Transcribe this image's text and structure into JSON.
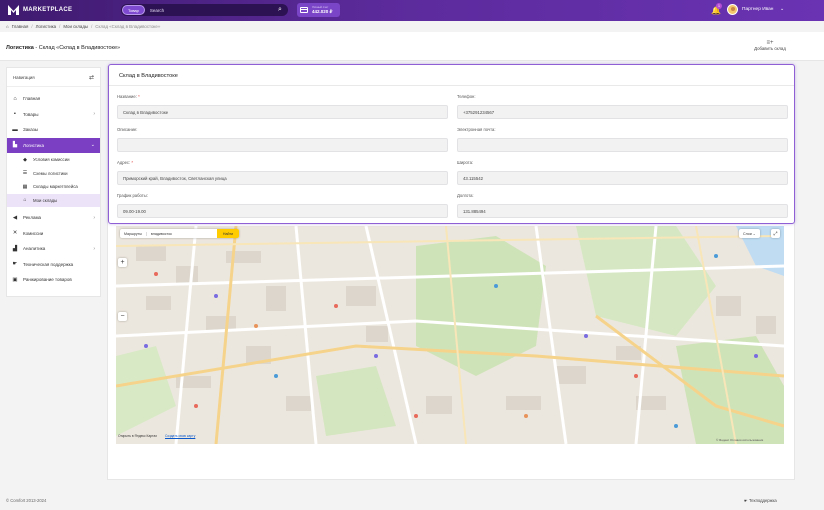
{
  "brand": {
    "name": "MARKETPLACE"
  },
  "search": {
    "scope": "Товар",
    "placeholder": "Search"
  },
  "balance": {
    "label": "Личный счет",
    "value": "442.020 ₽"
  },
  "notifications": {
    "count": "1"
  },
  "user": {
    "name": "Партнер Иван"
  },
  "breadcrumbs": {
    "home": "Главная",
    "logistics": "Логистика",
    "warehouses": "Мои склады",
    "current": "Склад «Склад в Владивостоке»"
  },
  "page": {
    "section": "Логистика",
    "title": " - Склад «Склад в Владивостоке»"
  },
  "add_warehouse": {
    "label": "Добавить склад"
  },
  "nav": {
    "title": "Навигация",
    "items": {
      "home": "Главная",
      "goods": "Товары",
      "orders": "Заказы",
      "logistics": "Логистика",
      "commission_terms": "Условия комиссии",
      "logistics_schemes": "Схемы логистики",
      "marketplace_warehouses": "Склады маркетплейса",
      "my_warehouses": "Мои склады",
      "ads": "Реклама",
      "commissions": "Комиссии",
      "analytics": "Аналитика",
      "support": "Техническая поддержка",
      "ranking": "Ранжирование товаров"
    }
  },
  "form": {
    "title": "Склад в Владивостоке",
    "name_label": "Название:",
    "name_value": "Склад в Владивостоке",
    "phone_label": "Телефон:",
    "phone_value": "+375291234567",
    "description_label": "Описание:",
    "description_value": "",
    "email_label": "Электронная почта:",
    "email_value": "",
    "address_label": "Адрес:",
    "address_value": "Приморский край, Владивосток, Светланская улица",
    "latitude_label": "Широта:",
    "latitude_value": "43.115542",
    "schedule_label": "График работы:",
    "schedule_value": "09.00-19.00",
    "longitude_label": "Долгота:",
    "longitude_value": "131.885494",
    "required_mark": "*"
  },
  "map": {
    "route_label": "Маршруты",
    "search_value": "владивосток",
    "find_label": "Найти",
    "layers_label": "Слои",
    "open_in_yandex": "Открыть в Яндекс Картах",
    "create_own_map": "Создать свою карту",
    "copyright": "© Яндекс Условия использования"
  },
  "footer": {
    "copyright": "© Comfort 2013-2024",
    "support": "Техподдержка"
  },
  "colors": {
    "accent": "#7a3fc2",
    "topbar": "#5b2a9a"
  }
}
